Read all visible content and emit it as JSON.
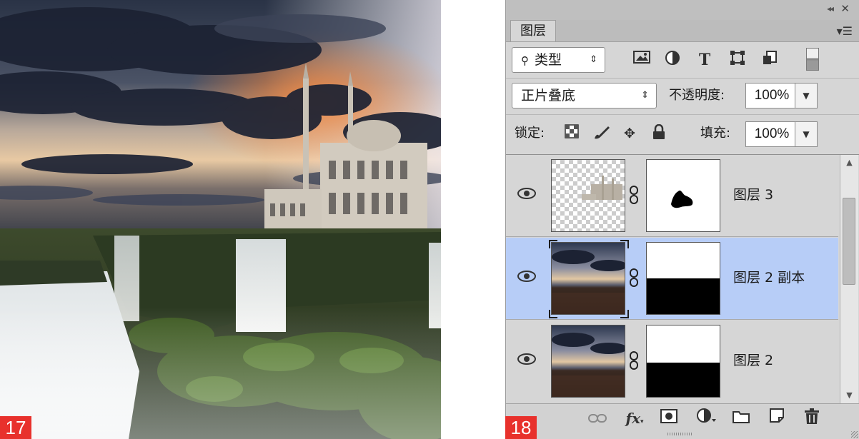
{
  "figures": {
    "left_label": "17",
    "right_label": "18"
  },
  "panel": {
    "tab_label": "图层",
    "filter": {
      "kind_label": "类型",
      "icons": [
        "image-filter-icon",
        "adjustment-filter-icon",
        "type-filter-icon",
        "shape-filter-icon",
        "smart-object-filter-icon"
      ]
    },
    "blend": {
      "mode": "正片叠底",
      "opacity_label": "不透明度:",
      "opacity_value": "100%"
    },
    "lock": {
      "label": "锁定:",
      "fill_label": "填充:",
      "fill_value": "100%"
    },
    "layers": [
      {
        "name": "图层 3",
        "selected": false,
        "visible": true
      },
      {
        "name": "图层 2 副本",
        "selected": true,
        "visible": true
      },
      {
        "name": "图层 2",
        "selected": false,
        "visible": true
      }
    ],
    "bottom_icons": [
      "link-layers-icon",
      "fx-icon",
      "add-mask-icon",
      "adjustment-layer-icon",
      "new-group-icon",
      "new-layer-icon",
      "delete-icon"
    ],
    "colors": {
      "panel_bg": "#d6d6d6",
      "selected_row": "#b7cdf7",
      "badge": "#e8312c"
    }
  }
}
